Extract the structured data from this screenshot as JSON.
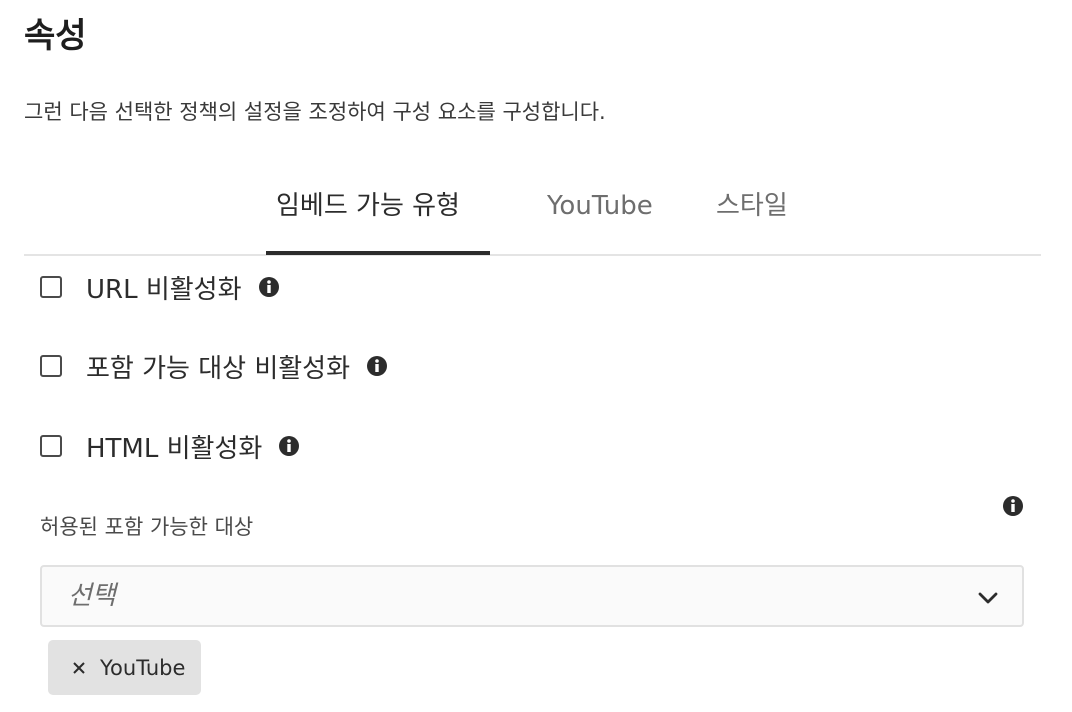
{
  "section_title": "속성",
  "description": "그런 다음 선택한 정책의 설정을 조정하여 구성 요소를 구성합니다.",
  "tabs": [
    {
      "label": "임베드 가능 유형",
      "active": true
    },
    {
      "label": "YouTube",
      "active": false
    },
    {
      "label": "스타일",
      "active": false
    }
  ],
  "options": [
    {
      "label": "URL 비활성화",
      "checked": false,
      "icon": "info-icon"
    },
    {
      "label": "포함 가능 대상 비활성화",
      "checked": false,
      "icon": "info-icon"
    },
    {
      "label": "HTML 비활성화",
      "checked": false,
      "icon": "info-icon"
    }
  ],
  "allowed_embeddables": {
    "label": "허용된 포함 가능한 대상",
    "placeholder": "선택",
    "icon": "chevron-down-icon",
    "selected_tags": [
      {
        "label": "YouTube",
        "remove_icon": "close-icon"
      }
    ]
  },
  "colors": {
    "text": "#2c2c2c",
    "muted": "#6e6e6e",
    "tag_background": "#e2e2e2",
    "active_tab_underline": "#2c2c2c"
  }
}
